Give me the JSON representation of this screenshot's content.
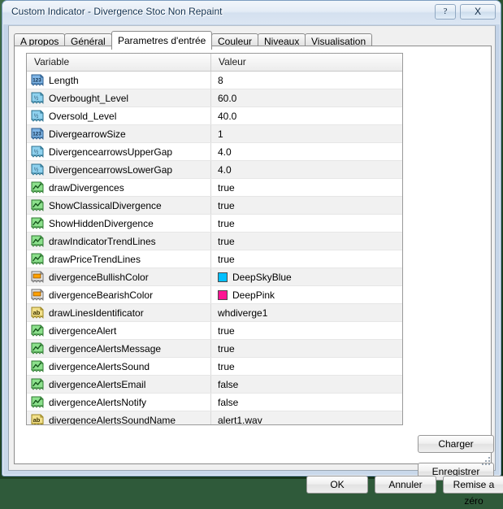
{
  "window": {
    "title": "Custom Indicator - Divergence Stoc Non Repaint",
    "help_label": "?",
    "close_label": "X"
  },
  "tabs": [
    {
      "label": "A propos",
      "active": false
    },
    {
      "label": "Général",
      "active": false
    },
    {
      "label": "Parametres d'entrée",
      "active": true
    },
    {
      "label": "Couleur",
      "active": false
    },
    {
      "label": "Niveaux",
      "active": false
    },
    {
      "label": "Visualisation",
      "active": false
    }
  ],
  "grid": {
    "columns": [
      "Variable",
      "Valeur"
    ],
    "rows": [
      {
        "icon": "integer-icon",
        "name": "Length",
        "value": "8"
      },
      {
        "icon": "double-icon",
        "name": "Overbought_Level",
        "value": "60.0"
      },
      {
        "icon": "double-icon",
        "name": "Oversold_Level",
        "value": "40.0"
      },
      {
        "icon": "integer-icon",
        "name": "DivergearrowSize",
        "value": "1"
      },
      {
        "icon": "double-icon",
        "name": "DivergencearrowsUpperGap",
        "value": "4.0"
      },
      {
        "icon": "double-icon",
        "name": "DivergencearrowsLowerGap",
        "value": "4.0"
      },
      {
        "icon": "boolean-icon",
        "name": "drawDivergences",
        "value": "true"
      },
      {
        "icon": "boolean-icon",
        "name": "ShowClassicalDivergence",
        "value": "true"
      },
      {
        "icon": "boolean-icon",
        "name": "ShowHiddenDivergence",
        "value": "true"
      },
      {
        "icon": "boolean-icon",
        "name": "drawIndicatorTrendLines",
        "value": "true"
      },
      {
        "icon": "boolean-icon",
        "name": "drawPriceTrendLines",
        "value": "true"
      },
      {
        "icon": "color-icon",
        "name": "divergenceBullishColor",
        "value": "DeepSkyBlue",
        "swatch": "#00BFFF"
      },
      {
        "icon": "color-icon",
        "name": "divergenceBearishColor",
        "value": "DeepPink",
        "swatch": "#FF1493"
      },
      {
        "icon": "string-icon",
        "name": "drawLinesIdentificator",
        "value": "whdiverge1"
      },
      {
        "icon": "boolean-icon",
        "name": "divergenceAlert",
        "value": "true"
      },
      {
        "icon": "boolean-icon",
        "name": "divergenceAlertsMessage",
        "value": "true"
      },
      {
        "icon": "boolean-icon",
        "name": "divergenceAlertsSound",
        "value": "true"
      },
      {
        "icon": "boolean-icon",
        "name": "divergenceAlertsEmail",
        "value": "false"
      },
      {
        "icon": "boolean-icon",
        "name": "divergenceAlertsNotify",
        "value": "false"
      },
      {
        "icon": "string-icon",
        "name": "divergenceAlertsSoundName",
        "value": "alert1.wav"
      }
    ]
  },
  "side_buttons": {
    "load_label": "Charger",
    "save_label": "Enregistrer"
  },
  "bottom_buttons": {
    "ok_label": "OK",
    "cancel_label": "Annuler",
    "reset_label": "Remise a zéro"
  }
}
